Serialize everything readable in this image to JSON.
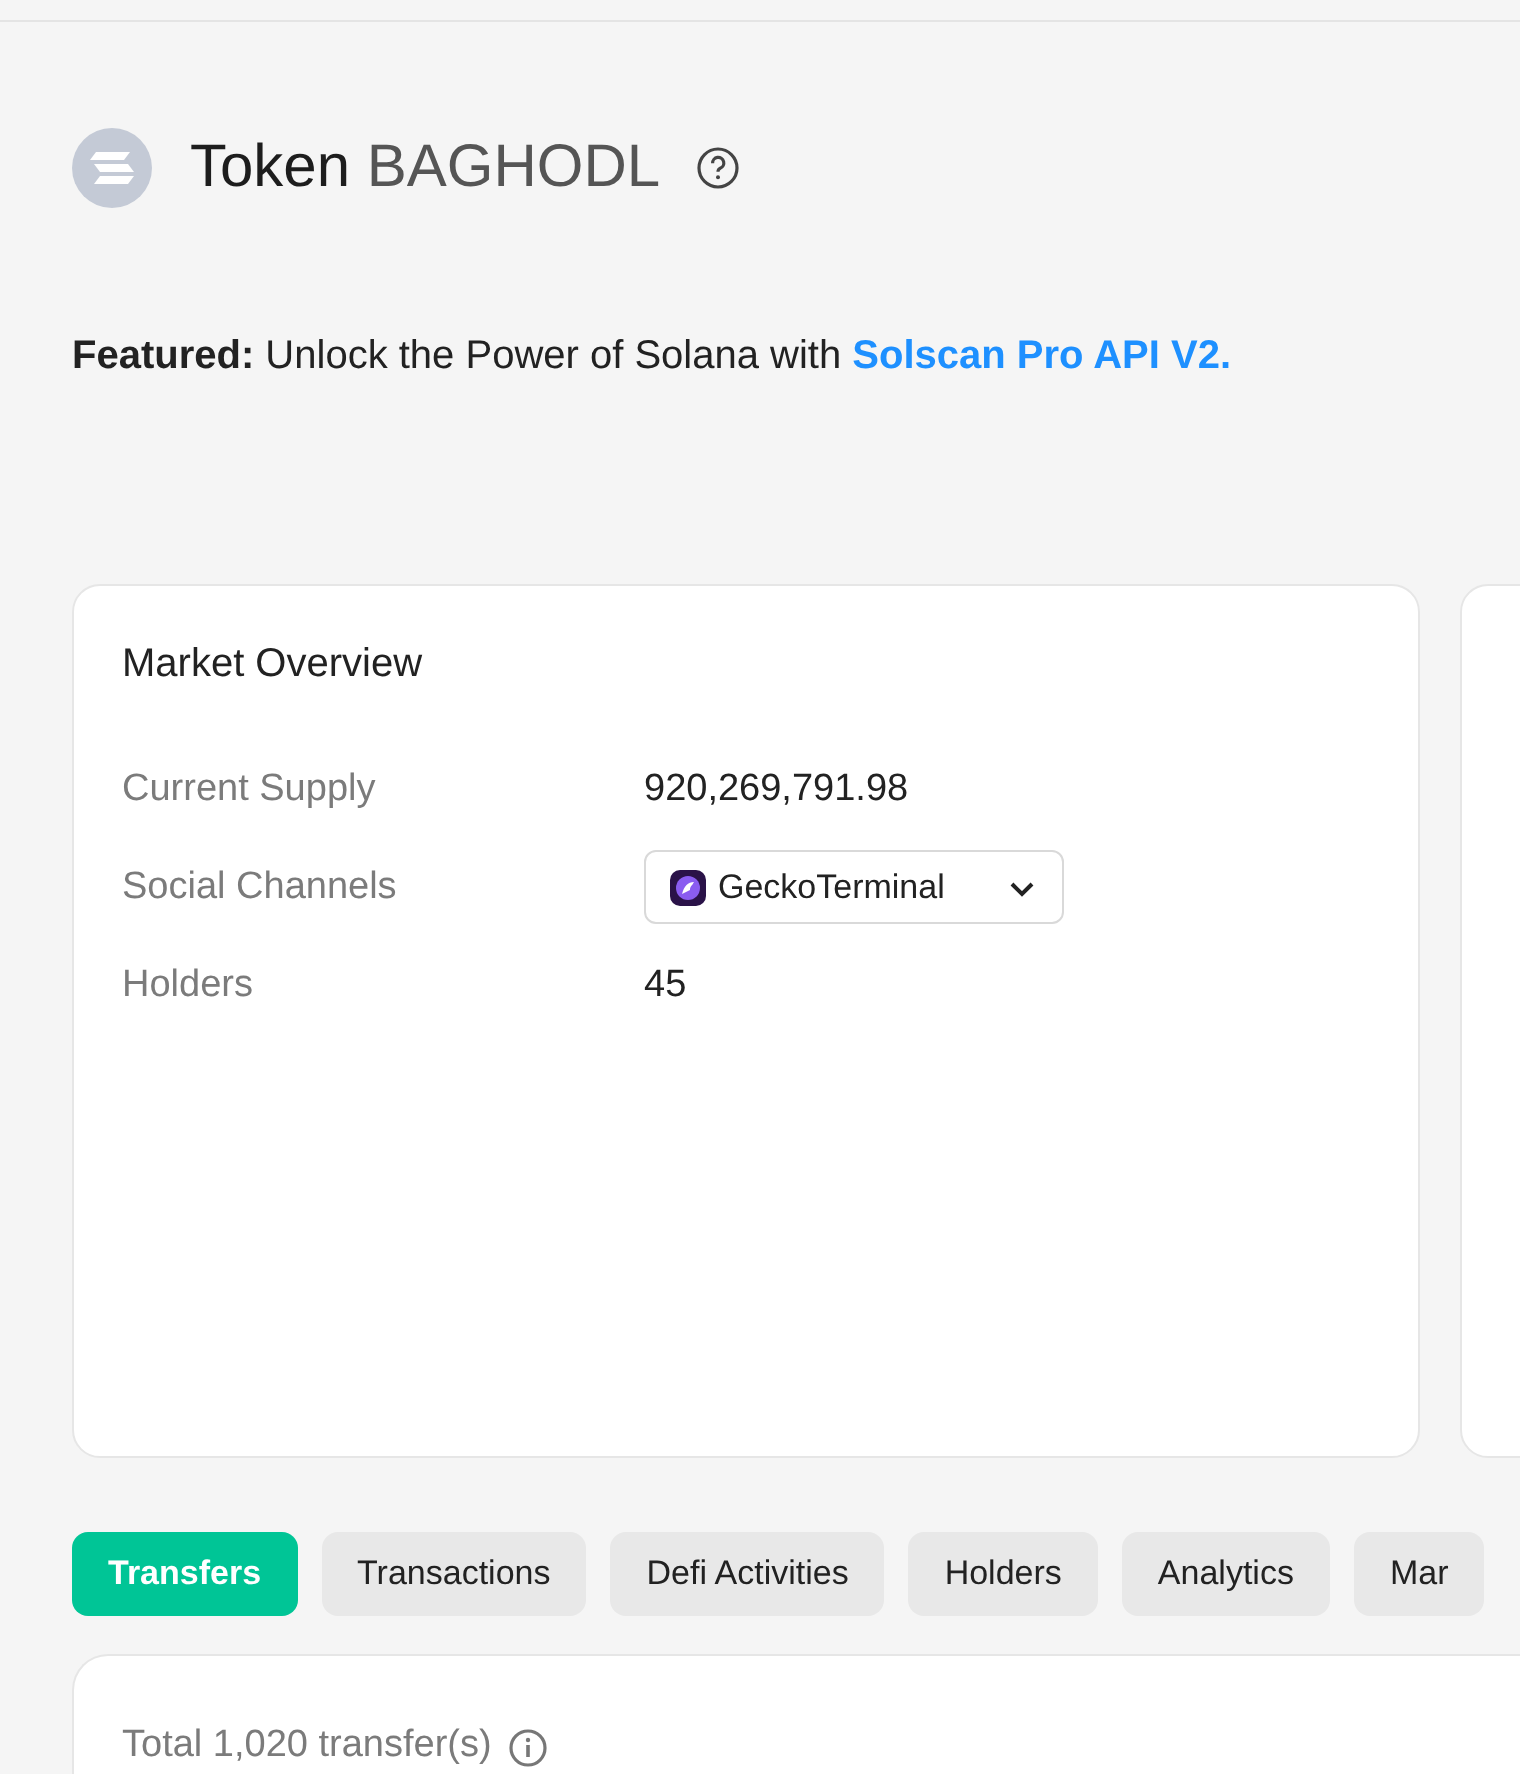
{
  "header": {
    "prefix": "Token",
    "name": "BAGHODL"
  },
  "featured": {
    "label": "Featured:",
    "text": "Unlock the Power of Solana with",
    "link": "Solscan Pro API V2."
  },
  "market_overview": {
    "title": "Market Overview",
    "rows": [
      {
        "label": "Current Supply",
        "kind": "text",
        "value": "920,269,791.98"
      },
      {
        "label": "Social Channels",
        "kind": "dropdown",
        "value": "GeckoTerminal"
      },
      {
        "label": "Holders",
        "kind": "text",
        "value": "45"
      }
    ]
  },
  "tabs": [
    {
      "label": "Transfers",
      "selected": true
    },
    {
      "label": "Transactions",
      "selected": false
    },
    {
      "label": "Defi Activities",
      "selected": false
    },
    {
      "label": "Holders",
      "selected": false
    },
    {
      "label": "Analytics",
      "selected": false
    },
    {
      "label": "Mar",
      "selected": false
    }
  ],
  "transfers": {
    "total": "Total 1,020 transfer(s)"
  }
}
